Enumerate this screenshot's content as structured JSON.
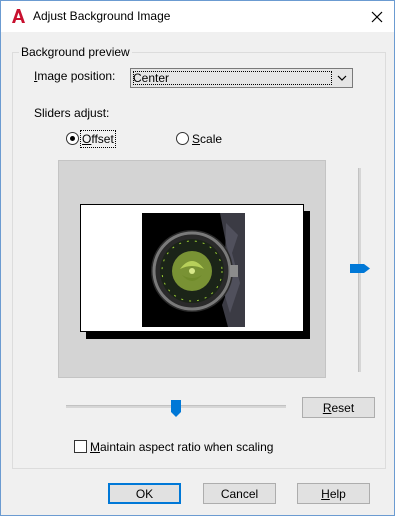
{
  "window": {
    "title": "Adjust Background Image"
  },
  "preview_group": {
    "title": "Background preview",
    "image_position": {
      "label": "Image position:",
      "mnemonic": "I",
      "rest": "mage position:",
      "value": "Center"
    },
    "sliders_adjust_label": "Sliders adjust:",
    "radios": [
      {
        "label": "Offset",
        "mnemonic": "O",
        "rest": "ffset",
        "selected": true
      },
      {
        "label": "Scale",
        "mnemonic": "S",
        "rest": "cale",
        "selected": false
      }
    ],
    "reset_button": {
      "label": "Reset",
      "mnemonic": "R",
      "rest": "eset"
    },
    "maintain_aspect": {
      "label": "Maintain aspect ratio when scaling",
      "mnemonic": "M",
      "rest": "aintain aspect ratio when scaling",
      "checked": false
    }
  },
  "footer": {
    "ok": "OK",
    "cancel": "Cancel",
    "help": {
      "label": "Help",
      "mnemonic": "H",
      "rest": "elp"
    }
  },
  "colors": {
    "accent": "#0078d7",
    "app_icon": "#c8102e",
    "preview_bg": "#d4d4d4"
  },
  "icons": {
    "app": "autocad-logo-icon",
    "close": "close-icon",
    "dropdown": "chevron-down-icon"
  }
}
